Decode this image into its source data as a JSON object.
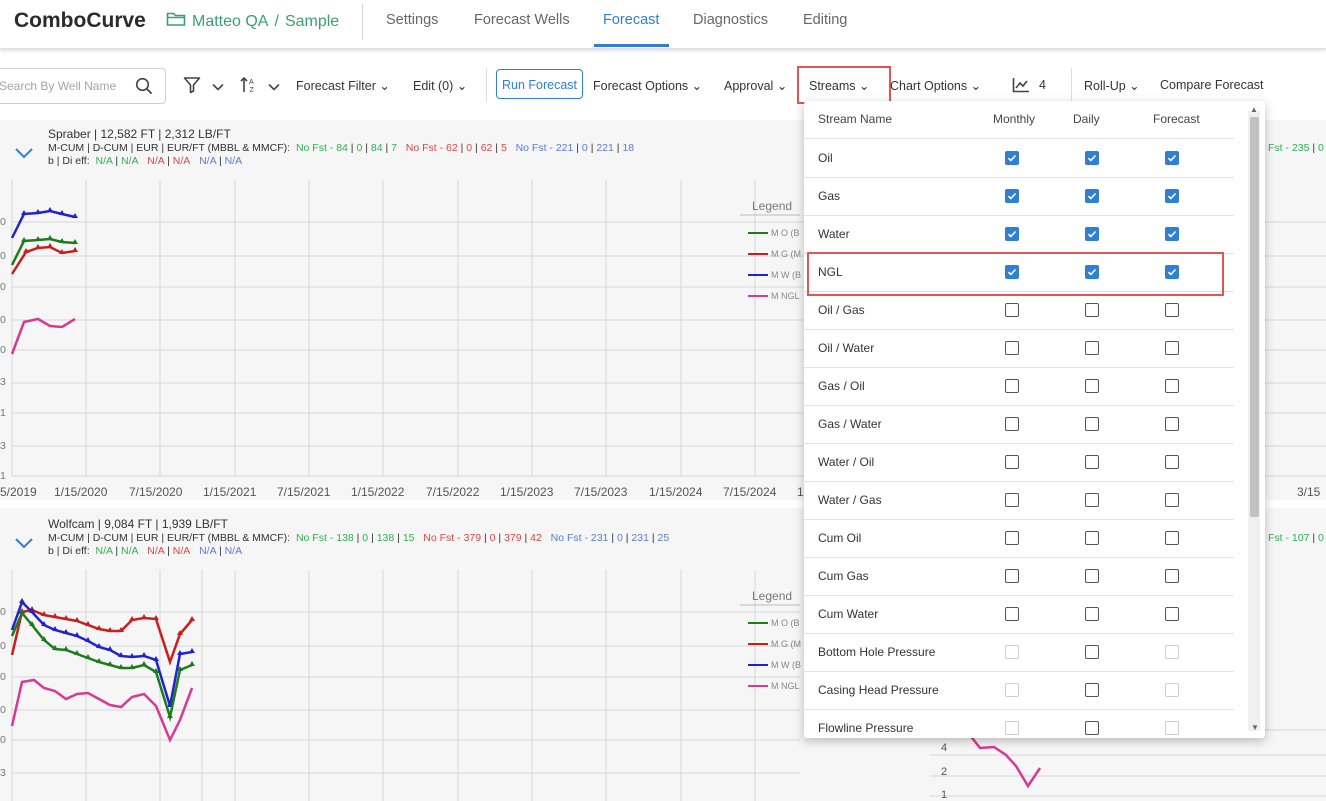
{
  "app": {
    "title": "ComboCurve"
  },
  "breadcrumb": {
    "project": "Matteo QA",
    "separator": "/",
    "scenario": "Sample"
  },
  "nav": {
    "tabs": [
      "Settings",
      "Forecast Wells",
      "Forecast",
      "Diagnostics",
      "Editing"
    ],
    "active": "Forecast"
  },
  "toolbar": {
    "search_placeholder": "Search By Well Name",
    "forecast_filter": "Forecast Filter",
    "edit": "Edit (0)",
    "run_forecast": "Run Forecast",
    "forecast_options": "Forecast Options",
    "approval": "Approval",
    "streams": "Streams",
    "chart_options": "Chart Options",
    "chart_count": "4",
    "rollup": "Roll-Up",
    "compare": "Compare Forecast"
  },
  "wells": [
    {
      "name": "Spraber | 12,582 FT | 2,312 LB/FT",
      "row1_label": "M-CUM | D-CUM | EUR | EUR/FT (MBBL & MMCF):",
      "oil": [
        "No Fst - 84",
        "0",
        "84",
        "7"
      ],
      "gas": [
        "No Fst - 62",
        "0",
        "62",
        "5"
      ],
      "water": [
        "No Fst - 221",
        "0",
        "221",
        "18"
      ],
      "row2_label": "b | Di eff:",
      "b_vals": [
        "N/A",
        "N/A",
        "N/A",
        "N/A",
        "N/A",
        "N/A"
      ],
      "right_cut": "Fst - 235",
      "legend_title": "Legend",
      "legend": [
        "M O (B",
        "M G (M",
        "M W (B",
        "M NGL"
      ],
      "xticks": [
        "5/2019",
        "1/15/2020",
        "7/15/2020",
        "1/15/2021",
        "7/15/2021",
        "1/15/2022",
        "7/15/2022",
        "1/15/2023",
        "7/15/2023",
        "1/15/2024",
        "7/15/2024",
        "1"
      ],
      "xtick_right": "3/15",
      "yticks": [
        "0",
        "0",
        "0",
        "0",
        "0",
        "3",
        "1",
        "3",
        "1"
      ]
    },
    {
      "name": "Wolfcam | 9,084 FT | 1,939 LB/FT",
      "row1_label": "M-CUM | D-CUM | EUR | EUR/FT (MBBL & MMCF):",
      "oil": [
        "No Fst - 138",
        "0",
        "138",
        "15"
      ],
      "gas": [
        "No Fst - 379",
        "0",
        "379",
        "42"
      ],
      "water": [
        "No Fst - 231",
        "0",
        "231",
        "25"
      ],
      "row2_label": "b | Di eff:",
      "b_vals": [
        "N/A",
        "N/A",
        "N/A",
        "N/A",
        "N/A",
        "N/A"
      ],
      "right_cut": "Fst - 107",
      "legend_title": "Legend",
      "legend": [
        "M O (B",
        "M G (M",
        "M W (B",
        "M NGL"
      ],
      "yticks": [
        "0",
        "0",
        "0",
        "0",
        "0",
        "0",
        "3"
      ],
      "right_yticks": [
        "4",
        "2",
        "1"
      ]
    }
  ],
  "streams_popup": {
    "headers": {
      "name": "Stream Name",
      "monthly": "Monthly",
      "daily": "Daily",
      "forecast": "Forecast"
    },
    "rows": [
      {
        "name": "Oil",
        "monthly": "checked",
        "daily": "checked",
        "forecast": "checked"
      },
      {
        "name": "Gas",
        "monthly": "checked",
        "daily": "checked",
        "forecast": "checked"
      },
      {
        "name": "Water",
        "monthly": "checked",
        "daily": "checked",
        "forecast": "checked"
      },
      {
        "name": "NGL",
        "monthly": "checked",
        "daily": "checked",
        "forecast": "checked"
      },
      {
        "name": "Oil / Gas",
        "monthly": "unchecked",
        "daily": "unchecked",
        "forecast": "unchecked"
      },
      {
        "name": "Oil / Water",
        "monthly": "unchecked",
        "daily": "unchecked",
        "forecast": "unchecked"
      },
      {
        "name": "Gas / Oil",
        "monthly": "unchecked",
        "daily": "unchecked",
        "forecast": "unchecked"
      },
      {
        "name": "Gas / Water",
        "monthly": "unchecked",
        "daily": "unchecked",
        "forecast": "unchecked"
      },
      {
        "name": "Water / Oil",
        "monthly": "unchecked",
        "daily": "unchecked",
        "forecast": "unchecked"
      },
      {
        "name": "Water / Gas",
        "monthly": "unchecked",
        "daily": "unchecked",
        "forecast": "unchecked"
      },
      {
        "name": "Cum Oil",
        "monthly": "unchecked",
        "daily": "unchecked",
        "forecast": "unchecked"
      },
      {
        "name": "Cum Gas",
        "monthly": "unchecked",
        "daily": "unchecked",
        "forecast": "unchecked"
      },
      {
        "name": "Cum Water",
        "monthly": "unchecked",
        "daily": "unchecked",
        "forecast": "unchecked"
      },
      {
        "name": "Bottom Hole Pressure",
        "monthly": "disabled",
        "daily": "unchecked",
        "forecast": "disabled"
      },
      {
        "name": "Casing Head Pressure",
        "monthly": "disabled",
        "daily": "unchecked",
        "forecast": "disabled"
      },
      {
        "name": "Flowline Pressure",
        "monthly": "disabled",
        "daily": "unchecked",
        "forecast": "disabled"
      }
    ]
  },
  "colors": {
    "accent": "#2f7fd3",
    "brand_green": "#3aa16f",
    "highlight": "#e05555",
    "oil": "#1e7b1e",
    "gas": "#c81e1e",
    "water": "#2222cc",
    "ngl": "#d63a94"
  },
  "icons": [
    "folder-icon",
    "search-icon",
    "filter-icon",
    "sort-icon",
    "chevron-down-icon",
    "chart-icon",
    "expand-icon",
    "checkbox-icon"
  ]
}
